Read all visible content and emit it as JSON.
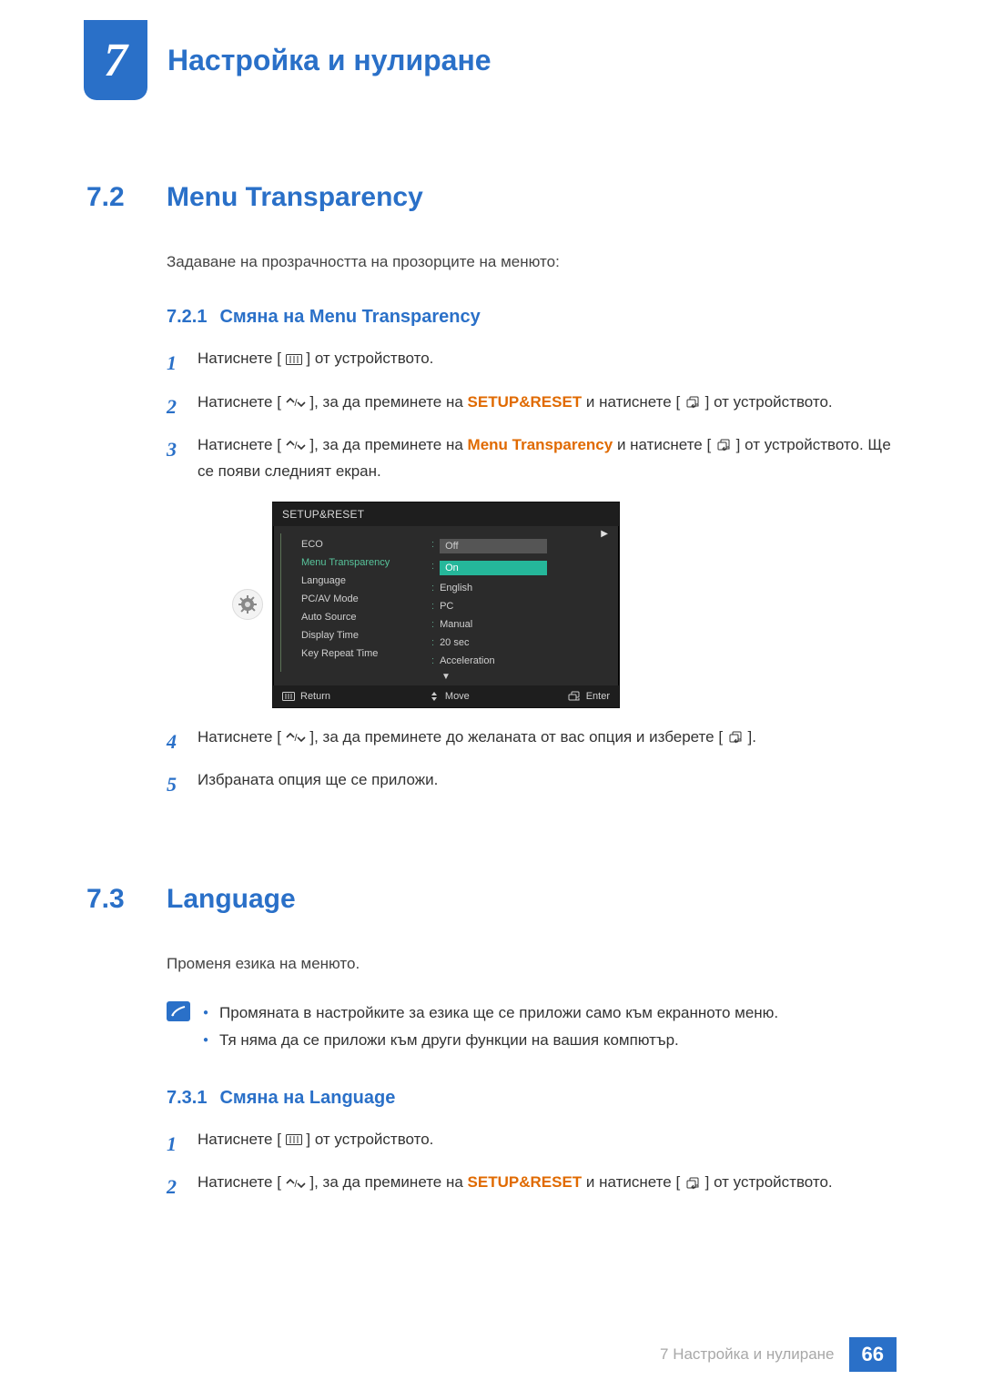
{
  "chapter": {
    "number": "7",
    "title": "Настройка и нулиране"
  },
  "section72": {
    "num": "7.2",
    "title": "Menu Transparency",
    "intro": "Задаване на прозрачността на прозорците на менюто:",
    "sub": {
      "num": "7.2.1",
      "title": "Смяна на Menu Transparency"
    },
    "steps": {
      "s1": {
        "n": "1",
        "a": "Натиснете [",
        "b": "] от устройството."
      },
      "s2": {
        "n": "2",
        "a": "Натиснете [",
        "b": "], за да преминете на ",
        "hl": "SETUP&RESET",
        "c": " и натиснете [",
        "d": "] от устройството."
      },
      "s3": {
        "n": "3",
        "a": "Натиснете [",
        "b": "], за да преминете на ",
        "hl": "Menu Transparency",
        "c": " и натиснете [",
        "d": "] от устройството. Ще се появи следният екран."
      },
      "s4": {
        "n": "4",
        "a": "Натиснете [",
        "b": "], за да преминете до желаната от вас опция и изберете [",
        "c": "]."
      },
      "s5": {
        "n": "5",
        "text": "Избраната опция ще се приложи."
      }
    }
  },
  "osd": {
    "title": "SETUP&RESET",
    "labels": {
      "eco": "ECO",
      "mt": "Menu Transparency",
      "lang": "Language",
      "pcav": "PC/AV Mode",
      "auto": "Auto Source",
      "disp": "Display Time",
      "krt": "Key Repeat Time"
    },
    "dropdown": {
      "off": "Off",
      "on": "On"
    },
    "values": {
      "lang": "English",
      "pcav": "PC",
      "auto": "Manual",
      "disp": "20 sec",
      "krt": "Acceleration"
    },
    "foot": {
      "ret": "Return",
      "mov": "Move",
      "ent": "Enter"
    }
  },
  "section73": {
    "num": "7.3",
    "title": "Language",
    "intro": "Променя езика на менюто.",
    "notes": {
      "n1": "Промяната в настройките за езика ще се приложи само към екранното меню.",
      "n2": "Тя няма да се приложи към други функции на вашия компютър."
    },
    "sub": {
      "num": "7.3.1",
      "title": "Смяна на Language"
    },
    "steps": {
      "s1": {
        "n": "1",
        "a": "Натиснете [",
        "b": "] от устройството."
      },
      "s2": {
        "n": "2",
        "a": "Натиснете [",
        "b": "], за да преминете на ",
        "hl": "SETUP&RESET",
        "c": " и натиснете [",
        "d": "] от устройството."
      }
    }
  },
  "footer": {
    "label": "7 Настройка и нулиране",
    "page": "66"
  }
}
